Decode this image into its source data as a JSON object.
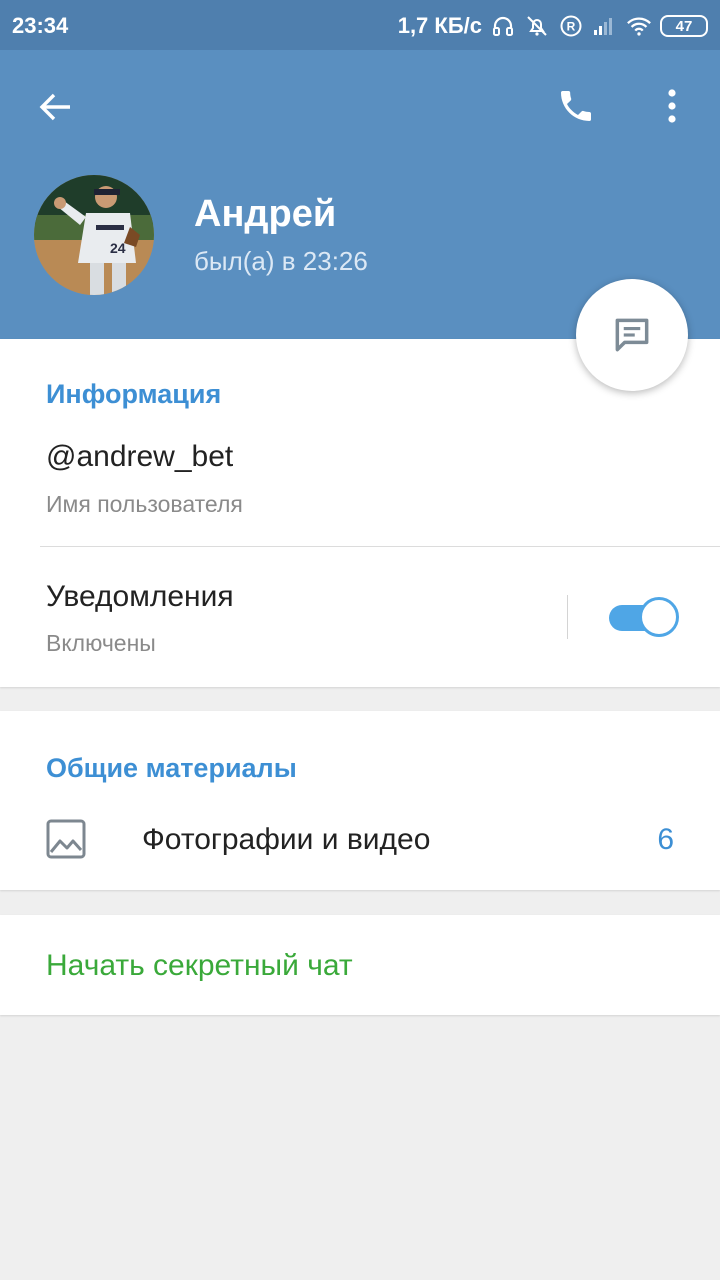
{
  "status_bar": {
    "time": "23:34",
    "network_speed": "1,7 КБ/с",
    "battery": "47",
    "icons": [
      "headphones-icon",
      "bell-off-icon",
      "roaming-icon",
      "signal-icon",
      "wifi-icon",
      "battery-icon"
    ]
  },
  "header": {
    "back_icon": "arrow-left-icon",
    "call_icon": "phone-icon",
    "menu_icon": "more-vert-icon",
    "name": "Андрей",
    "status": "был(а) в 23:26",
    "fab_icon": "message-icon"
  },
  "info": {
    "title": "Информация",
    "username": "@andrew_bet",
    "username_caption": "Имя пользователя",
    "notifications_label": "Уведомления",
    "notifications_state": "Включены",
    "notifications_on": true
  },
  "media": {
    "title": "Общие материалы",
    "photos_label": "Фотографии и видео",
    "photos_count": "6",
    "photos_icon": "image-icon"
  },
  "secret_chat": {
    "label": "Начать секретный чат"
  },
  "colors": {
    "status_bar": "#4f7fae",
    "header": "#5a8fc0",
    "accent": "#3d8fd4",
    "secret": "#3aa93a",
    "toggle": "#4fa6e6",
    "background": "#efefef"
  }
}
